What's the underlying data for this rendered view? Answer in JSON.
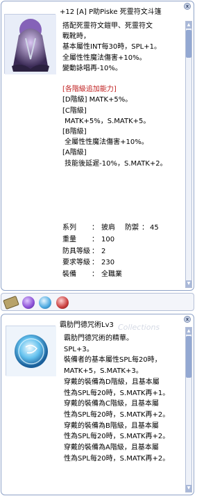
{
  "card1": {
    "title": "+12 [A] P助Piske 死靈符文斗篷",
    "close": "x",
    "description": [
      {
        "text": "搭配死靈符文鎧甲、死靈符文",
        "red": false
      },
      {
        "text": "戰靴時，",
        "red": false
      },
      {
        "text": "基本屬性INT每30時，SPL+1。",
        "red": false
      },
      {
        "text": "全屬性性魔法傷害+10%。",
        "red": false
      },
      {
        "text": "變動詠唱再-10%。",
        "red": false
      },
      {
        "text": "",
        "red": false
      },
      {
        "text": "[各階級追加能力]",
        "red": true
      },
      {
        "text": "[D階級] MATK+5%。",
        "red": false
      },
      {
        "text": "[C階級]",
        "red": false
      },
      {
        "text": " MATK+5%，S.MATK+5。",
        "red": false
      },
      {
        "text": "[B階級]",
        "red": false
      },
      {
        "text": " 全屬性性魔法傷害+10%。",
        "red": false
      },
      {
        "text": "[A階級]",
        "red": false
      },
      {
        "text": " 技能後延遲-10%，S.MATK+2。",
        "red": false
      }
    ],
    "stats": [
      {
        "label": "系列",
        "sep": "：",
        "value": "披肩",
        "extra_label": "防禦",
        "extra_value": "45"
      },
      {
        "label": "重量",
        "sep": "：",
        "value": "100",
        "extra_label": "",
        "extra_value": ""
      },
      {
        "label": "防具等級",
        "sep": "：",
        "value": "2",
        "extra_label": "",
        "extra_value": ""
      },
      {
        "label": "要求等級",
        "sep": "：",
        "value": "230",
        "extra_label": "",
        "extra_value": ""
      },
      {
        "label": "裝備",
        "sep": "：",
        "value": "全職業",
        "extra_label": "",
        "extra_value": ""
      }
    ]
  },
  "tray": {
    "icons": [
      "card-slot-icon",
      "purple-orb-icon",
      "blue-orb-icon",
      "red-orb-icon"
    ],
    "colors": [
      "#b8a36a",
      "#8a4fd6",
      "#4aa8e0",
      "#c83c3c"
    ]
  },
  "card2": {
    "title": "霸肋門德咒術Lv3",
    "watermark": "Collections",
    "close": "x",
    "description": [
      "霸肋門德咒術的精華。",
      "SPL+3。",
      "裝備者的基本屬性SPL每20時，",
      "MATK+5，S.MATK+3。",
      "穿戴的裝備為D階級，且基本屬",
      "性為SPL每20時，S.MATK再+1。",
      "穿戴的裝備為C階級，且基本屬",
      "性為SPL每20時，S.MATK再+2。",
      "穿戴的裝備為B階級，且基本屬",
      "性為SPL每20時，S.MATK再+2。",
      "穿戴的裝備為A階級，且基本屬",
      "性為SPL每20時，S.MATK再+2。"
    ]
  }
}
